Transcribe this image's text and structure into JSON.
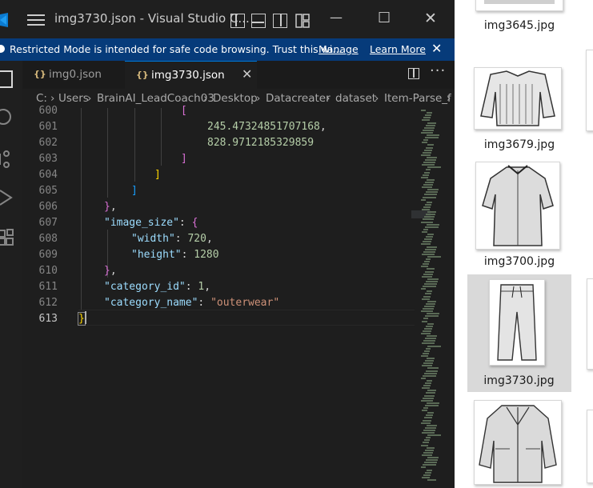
{
  "window": {
    "title": "img3730.json - Visual Studio C...",
    "minimize_glyph": "—",
    "maximize_glyph": "☐",
    "close_glyph": "✕"
  },
  "banner": {
    "message": "Restricted Mode is intended for safe code browsing. Trust this wi...",
    "manage": "Manage",
    "learn_more": "Learn More",
    "close_glyph": "✕"
  },
  "tabs": [
    {
      "icon": "{}",
      "label": "img0.json"
    },
    {
      "icon": "{}",
      "label": "img3730.json",
      "close": "✕"
    }
  ],
  "toolbar": {
    "more": "···"
  },
  "breadcrumb": [
    "C:",
    "Users",
    "BrainAI_LeadCoach03",
    "Desktop",
    "Datacreater",
    "dataset",
    "Item-Parse_f"
  ],
  "breadcrumb_sep": "›",
  "editor": {
    "line_numbers": [
      "600",
      "601",
      "602",
      "603",
      "604",
      "605",
      "606",
      "607",
      "608",
      "609",
      "610",
      "611",
      "612",
      "613"
    ],
    "current_line": "613",
    "lines": {
      "l600": "[",
      "l601_num": "245.47324851707168",
      "l601_comma": ",",
      "l602_num": "828.9712185329859",
      "l603": "]",
      "l604": "]",
      "l605": "]",
      "l606_brace": "}",
      "l606_comma": ",",
      "l607_key": "\"image_size\"",
      "l607_colon": ": ",
      "l607_brace": "{",
      "l608_key": "\"width\"",
      "l608_colon": ": ",
      "l608_val": "720",
      "l608_comma": ",",
      "l609_key": "\"height\"",
      "l609_colon": ": ",
      "l609_val": "1280",
      "l610_brace": "}",
      "l610_comma": ",",
      "l611_key": "\"category_id\"",
      "l611_colon": ": ",
      "l611_val": "1",
      "l611_comma": ",",
      "l612_key": "\"category_name\"",
      "l612_colon": ": ",
      "l612_val": "\"outerwear\"",
      "l613": "}"
    }
  },
  "explorer": {
    "files": [
      {
        "name": "img3645.jpg"
      },
      {
        "name": "img3679.jpg"
      },
      {
        "name": "img3700.jpg"
      },
      {
        "name": "img3730.jpg",
        "selected": true
      },
      {
        "name": ""
      }
    ]
  },
  "colors": {
    "banner_bg": "#063b7a",
    "editor_bg": "#1e1e1e",
    "json_key": "#9cdcfe",
    "json_number": "#b5cea8",
    "json_string": "#ce9178",
    "selection_bg": "#d9d9d9"
  }
}
